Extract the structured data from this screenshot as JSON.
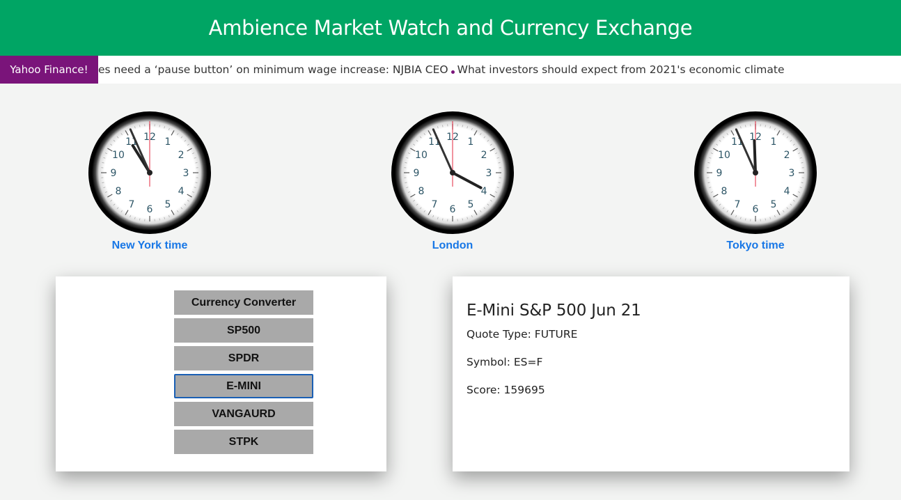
{
  "header": {
    "title": "Ambience Market Watch and Currency Exchange"
  },
  "ticker": {
    "label": "Yahoo Finance!",
    "items": [
      "es need a ‘pause button’ on minimum wage increase: NJBIA CEO",
      "What investors should expect from 2021's economic climate"
    ]
  },
  "clocks": [
    {
      "caption": "New York time",
      "time": "10:56"
    },
    {
      "caption": "London",
      "time": "3:56"
    },
    {
      "caption": "Tokyo time",
      "time": "11:56"
    }
  ],
  "menu": {
    "buttons": [
      "Currency Converter",
      "SP500",
      "SPDR",
      "E-MINI",
      "VANGAURD",
      "STPK"
    ],
    "active": "E-MINI"
  },
  "detail": {
    "title": "E-Mini S&P 500 Jun 21",
    "quote_type": "Quote Type: FUTURE",
    "symbol": "Symbol: ES=F",
    "score": "Score: 159695"
  },
  "colors": {
    "header_bg": "#00a564",
    "ticker_label_bg": "#7a147a",
    "caption": "#1877e6",
    "button_bg": "#a9a9a9",
    "second_hand": "#e0112b"
  }
}
